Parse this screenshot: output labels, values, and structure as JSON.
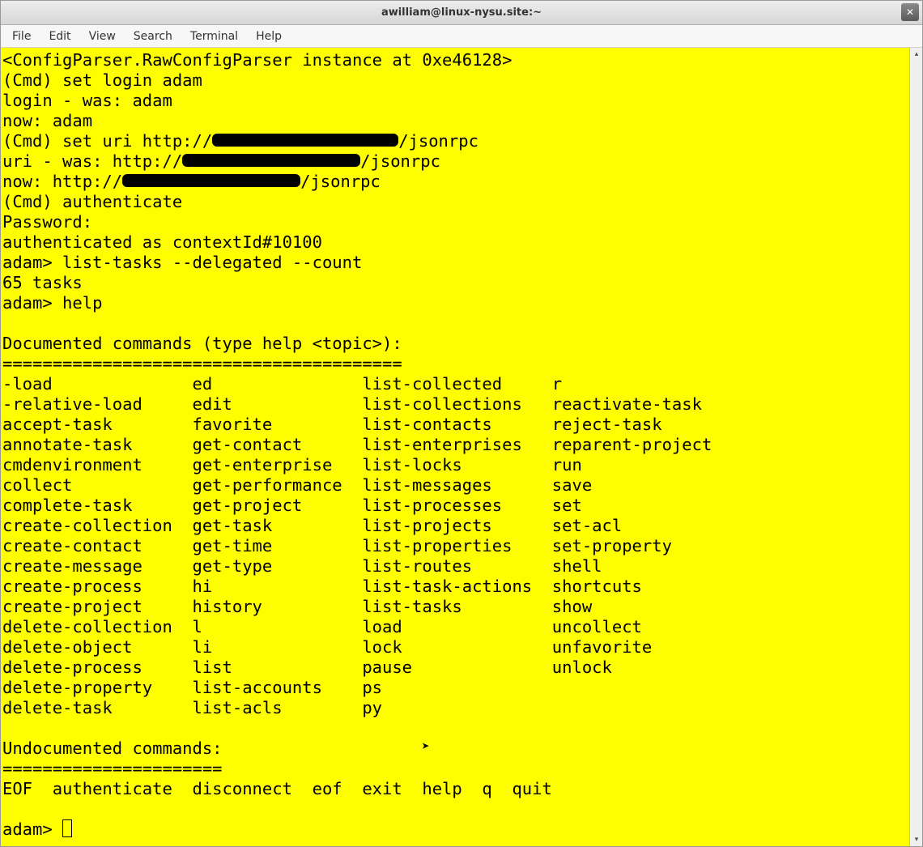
{
  "window": {
    "title": "awilliam@linux-nysu.site:~"
  },
  "menu": {
    "file": "File",
    "edit": "Edit",
    "view": "View",
    "search": "Search",
    "terminal": "Terminal",
    "help": "Help"
  },
  "terminal": {
    "line01": "<ConfigParser.RawConfigParser instance at 0xe46128>",
    "line02": "(Cmd) set login adam",
    "line03": "login - was: adam",
    "line04": "now: adam",
    "line05a": "(Cmd) set uri http://",
    "line05b": "/jsonrpc",
    "line06a": "uri - was: http://",
    "line06b": "/jsonrpc",
    "line07a": "now: http://",
    "line07b": "/jsonrpc",
    "line08": "(Cmd) authenticate",
    "line09": "Password:",
    "line10": "authenticated as contextId#10100",
    "line11": "adam> list-tasks --delegated --count",
    "line12": "65 tasks",
    "line13": "adam> help",
    "line14": "",
    "line15": "Documented commands (type help <topic>):",
    "line16": "========================================",
    "cmds": {
      "c1": [
        "-load",
        "-relative-load",
        "accept-task",
        "annotate-task",
        "cmdenvironment",
        "collect",
        "complete-task",
        "create-collection",
        "create-contact",
        "create-message",
        "create-process",
        "create-project",
        "delete-collection",
        "delete-object",
        "delete-process",
        "delete-property",
        "delete-task"
      ],
      "c2": [
        "ed",
        "edit",
        "favorite",
        "get-contact",
        "get-enterprise",
        "get-performance",
        "get-project",
        "get-task",
        "get-time",
        "get-type",
        "hi",
        "history",
        "l",
        "li",
        "list",
        "list-accounts",
        "list-acls"
      ],
      "c3": [
        "list-collected",
        "list-collections",
        "list-contacts",
        "list-enterprises",
        "list-locks",
        "list-messages",
        "list-processes",
        "list-projects",
        "list-properties",
        "list-routes",
        "list-task-actions",
        "list-tasks",
        "load",
        "lock",
        "pause",
        "ps",
        "py"
      ],
      "c4": [
        "r",
        "reactivate-task",
        "reject-task",
        "reparent-project",
        "run",
        "save",
        "set",
        "set-acl",
        "set-property",
        "shell",
        "shortcuts",
        "show",
        "uncollect",
        "unfavorite",
        "unlock",
        "",
        ""
      ]
    },
    "undoc_header": "Undocumented commands:",
    "undoc_sep": "======================",
    "undoc": "EOF  authenticate  disconnect  eof  exit  help  q  quit",
    "prompt": "adam> "
  }
}
